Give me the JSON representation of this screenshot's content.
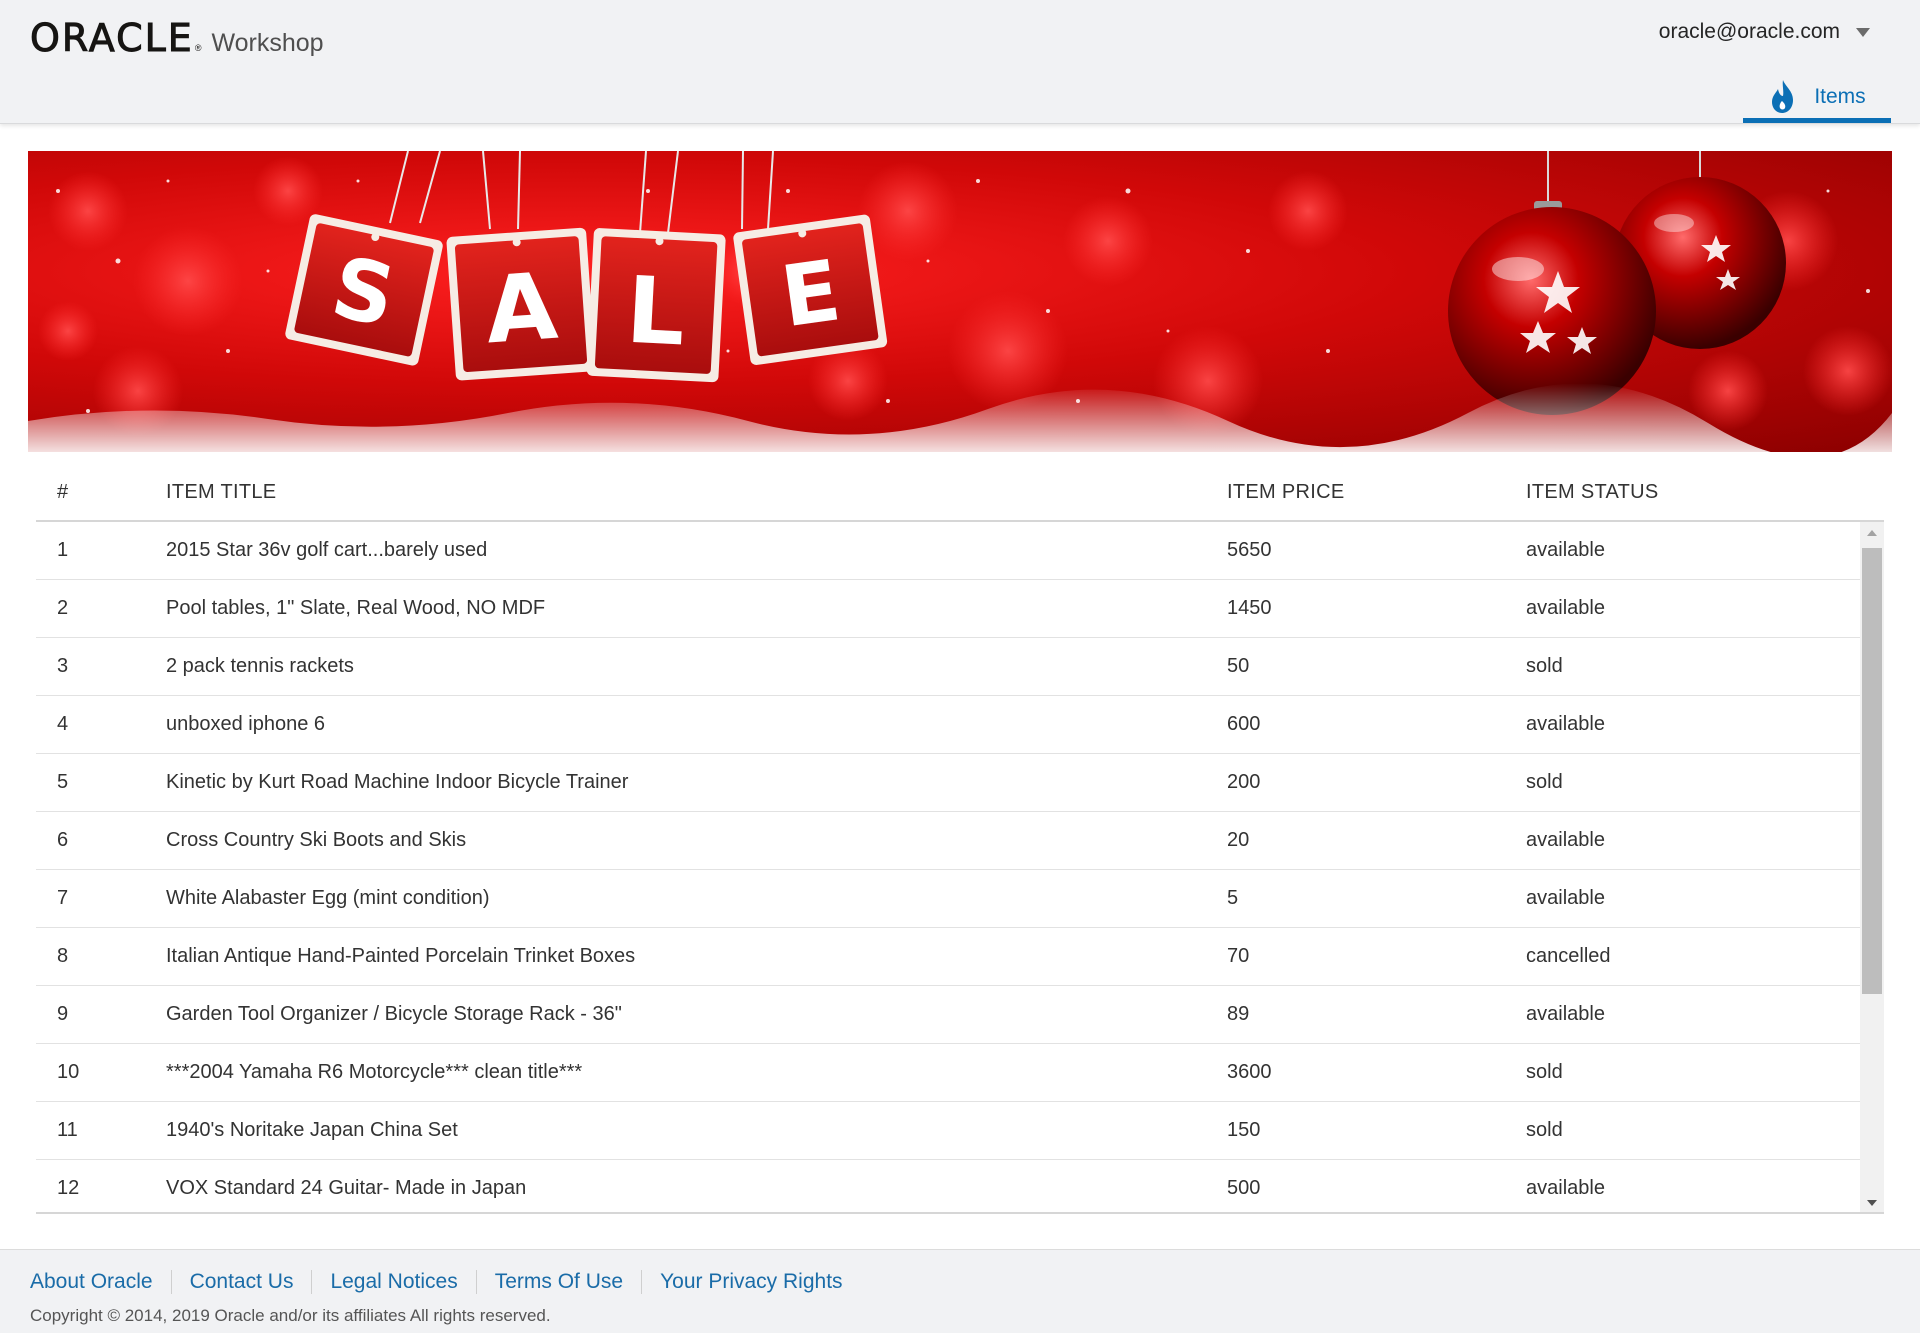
{
  "header": {
    "logo_text": "ORACLE",
    "logo_reg": "®",
    "app_name": "Workshop",
    "user_email": "oracle@oracle.com",
    "nav_tab_label": "Items",
    "accent_color": "#0b6fb5"
  },
  "banner": {
    "sale_letters": [
      "S",
      "A",
      "L",
      "E"
    ]
  },
  "table": {
    "columns": [
      "#",
      "ITEM TITLE",
      "ITEM PRICE",
      "ITEM STATUS"
    ],
    "rows": [
      {
        "num": "1",
        "title": "2015 Star 36v golf cart...barely used",
        "price": "5650",
        "status": "available"
      },
      {
        "num": "2",
        "title": "Pool tables, 1\" Slate, Real Wood, NO MDF",
        "price": "1450",
        "status": "available"
      },
      {
        "num": "3",
        "title": "2 pack tennis rackets",
        "price": "50",
        "status": "sold"
      },
      {
        "num": "4",
        "title": "unboxed iphone 6",
        "price": "600",
        "status": "available"
      },
      {
        "num": "5",
        "title": "Kinetic by Kurt Road Machine Indoor Bicycle Trainer",
        "price": "200",
        "status": "sold"
      },
      {
        "num": "6",
        "title": "Cross Country Ski Boots and Skis",
        "price": "20",
        "status": "available"
      },
      {
        "num": "7",
        "title": "White Alabaster Egg (mint condition)",
        "price": "5",
        "status": "available"
      },
      {
        "num": "8",
        "title": "Italian Antique Hand-Painted Porcelain Trinket Boxes",
        "price": "70",
        "status": "cancelled"
      },
      {
        "num": "9",
        "title": "Garden Tool Organizer / Bicycle Storage Rack - 36\"",
        "price": "89",
        "status": "available"
      },
      {
        "num": "10",
        "title": "***2004 Yamaha R6 Motorcycle*** clean title***",
        "price": "3600",
        "status": "sold"
      },
      {
        "num": "11",
        "title": "1940's Noritake Japan China Set",
        "price": "150",
        "status": "sold"
      },
      {
        "num": "12",
        "title": "VOX Standard 24 Guitar- Made in Japan",
        "price": "500",
        "status": "available"
      }
    ]
  },
  "footer": {
    "links": [
      "About Oracle",
      "Contact Us",
      "Legal Notices",
      "Terms Of Use",
      "Your Privacy Rights"
    ],
    "copyright": "Copyright © 2014, 2019 Oracle and/or its affiliates All rights reserved."
  }
}
